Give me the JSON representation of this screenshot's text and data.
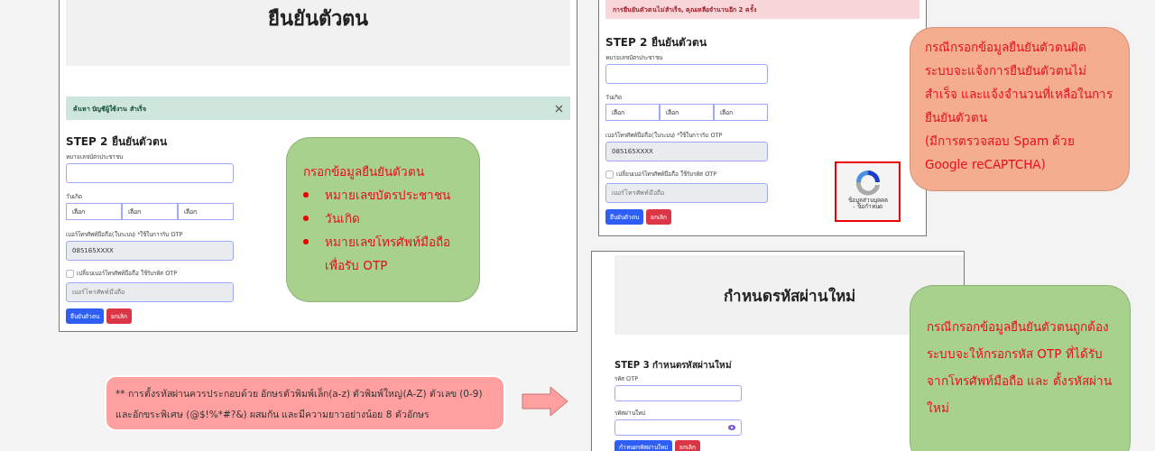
{
  "screens": [
    {
      "header_title": "ยืนยันตัวตน",
      "alert": {
        "kind": "success",
        "text": "ค้นหา บัญชีผู้ใช้งาน สำเร็จ",
        "dismissible": true
      },
      "step_heading": "STEP 2 ยืนยันตัวตน",
      "fields": [
        {
          "kind": "text",
          "label": "หมายเลขบัตรประชาชน",
          "disabled": false
        },
        {
          "kind": "selects",
          "label": "วันเกิด",
          "options": [
            "เลือก",
            "เลือก",
            "เลือก"
          ]
        },
        {
          "kind": "text",
          "label": "เบอร์โทรศัพท์มือถือ(ในระบบ) *ใช้ในการรับ OTP",
          "value": "085165XXXX",
          "disabled": true
        },
        {
          "kind": "checkbox",
          "label": "เปลี่ยนเบอร์โทรศัพท์มือถือ ใช้รับรหัส OTP",
          "checked": false
        },
        {
          "kind": "text",
          "placeholder": "เบอร์โทรศัพท์มือถือ",
          "disabled": true
        }
      ],
      "buttons": [
        {
          "kind": "primary",
          "label": "ยืนยันตัวตน"
        },
        {
          "kind": "danger",
          "label": "ยกเลิก"
        }
      ]
    },
    {
      "alert": {
        "kind": "danger",
        "text": "การยืนยันตัวตนไม่สำเร็จ, คุณเหลือจำนวนอีก 2 ครั้ง",
        "dismissible": false
      },
      "step_heading": "STEP 2 ยืนยันตัวตน",
      "fields": [
        {
          "kind": "text",
          "label": "หมายเลขบัตรประชาชน",
          "disabled": false
        },
        {
          "kind": "selects",
          "label": "วันเกิด",
          "options": [
            "เลือก",
            "เลือก",
            "เลือก"
          ]
        },
        {
          "kind": "text",
          "label": "เบอร์โทรศัพท์มือถือ(ในระบบ) *ใช้ในการรับ OTP",
          "value": "085165XXXX",
          "disabled": true
        },
        {
          "kind": "checkbox",
          "label": "เปลี่ยนเบอร์โทรศัพท์มือถือ ใช้รับรหัส OTP",
          "checked": false
        },
        {
          "kind": "text",
          "placeholder": "เบอร์โทรศัพท์มือถือ",
          "disabled": true
        }
      ],
      "buttons": [
        {
          "kind": "primary",
          "label": "ยืนยันตัวตน"
        },
        {
          "kind": "danger",
          "label": "ยกเลิก"
        }
      ],
      "captcha": {
        "lines": [
          "ข้อมูลส่วนบุคคล",
          "- ข้อกำหนด"
        ]
      }
    },
    {
      "header_title": "กำหนดรหัสผ่านใหม่",
      "step_heading": "STEP 3 กำหนดรหัสผ่านใหม่",
      "fields": [
        {
          "kind": "text",
          "label": "รหัส OTP",
          "disabled": false
        },
        {
          "kind": "password",
          "label": "รหัสผ่านใหม่"
        }
      ],
      "buttons": [
        {
          "kind": "primary",
          "label": "กำหนดรหัสผ่านใหม่"
        },
        {
          "kind": "danger",
          "label": "ยกเลิก"
        }
      ]
    }
  ],
  "callouts": [
    {
      "color": "#a9d18e",
      "title": "กรอกข้อมูลยืนยันตัวตน",
      "bullets": [
        "หมายเลขบัตรประชาชน",
        "วันเกิด",
        "หมายเลขโทรศัพท์มือถือเพื่อรับ OTP"
      ]
    },
    {
      "color": "#f5ad8f",
      "paragraphs": [
        "กรณีกรอกข้อมูลยืนยันตัวตนผิด ระบบจะแจ้งการยืนยันตัวตนไม่สำเร็จ และแจ้งจำนวนที่เหลือในการยืนยันตัวตน",
        "(มีการตรวจสอบ Spam ด้วย Google reCAPTCHA)"
      ]
    },
    {
      "color": "#a9d18e",
      "paragraphs": [
        "กรณีกรอกข้อมูลยืนยันตัวตนถูกต้อง ระบบจะให้กรอกรหัส OTP ที่ได้รับจากโทรศัพท์มือถือ และ ตั้งรหัสผ่านใหม่"
      ]
    }
  ],
  "note": "** การตั้งรหัสผ่านควรประกอบด้วย อักษรตัวพิมพ์เล็ก(a-z) ตัวพิมพ์ใหญ่(A-Z) ตัวเลข (0-9) และอักขระพิเศษ (@$!%*#?&) ผสมกัน และมีความยาวอย่างน้อย 8 ตัวอักษร"
}
